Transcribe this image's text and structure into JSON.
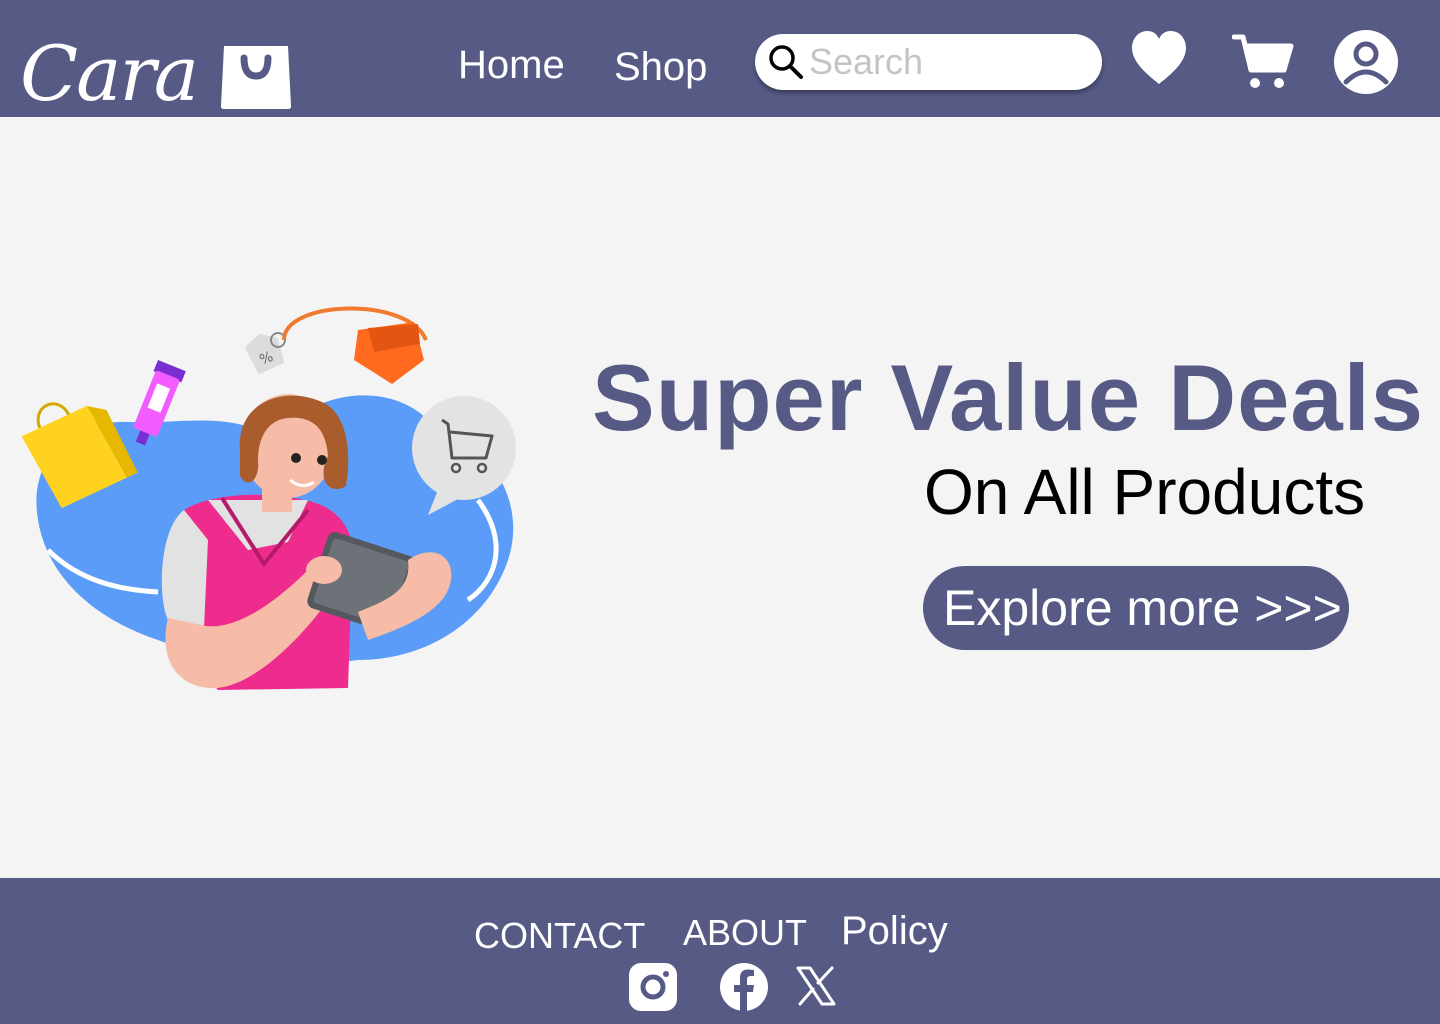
{
  "header": {
    "logo_text": "Cara",
    "nav": {
      "home": "Home",
      "shop": "Shop"
    },
    "search": {
      "placeholder": "Search",
      "value": ""
    },
    "icons": [
      "search-icon",
      "heart-icon",
      "cart-icon",
      "user-icon"
    ]
  },
  "hero": {
    "title": "Super Value Deals",
    "subtitle": "On All Products",
    "button": "Explore more >>>"
  },
  "footer": {
    "links": {
      "contact": "CONTACT",
      "about": "ABOUT",
      "policy": "Policy"
    },
    "social_icons": [
      "instagram-icon",
      "facebook-icon",
      "x-icon"
    ]
  },
  "colors": {
    "brand": "#565a85",
    "background": "#f4f4f5",
    "title_text": "#565a85",
    "subtitle_text": "#000000",
    "footer_text": "#ffffff"
  }
}
